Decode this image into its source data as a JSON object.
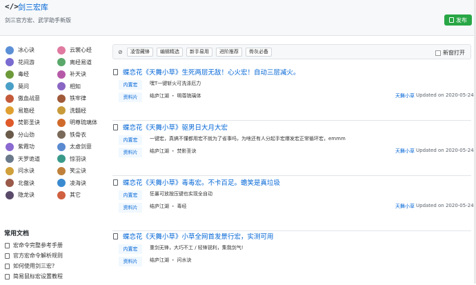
{
  "header": {
    "title": "剑三宏库",
    "subtitle": "剑三官方宏、武学助手新版",
    "publish_label": "发布"
  },
  "sidebar": {
    "categories": [
      {
        "label": "冰心诀",
        "color": "#5b8fd6"
      },
      {
        "label": "云裳心经",
        "color": "#e07aa0"
      },
      {
        "label": "花间游",
        "color": "#7a6bd0"
      },
      {
        "label": "离经易道",
        "color": "#5aa86a"
      },
      {
        "label": "毒经",
        "color": "#6c9a3a"
      },
      {
        "label": "补天诀",
        "color": "#b65aa8"
      },
      {
        "label": "莫问",
        "color": "#4a9fc7"
      },
      {
        "label": "相知",
        "color": "#8a66c4"
      },
      {
        "label": "傲血战意",
        "color": "#c45a3a"
      },
      {
        "label": "铁牢律",
        "color": "#a05a3a"
      },
      {
        "label": "易筋经",
        "color": "#e0a030"
      },
      {
        "label": "洗髓经",
        "color": "#c89a3a"
      },
      {
        "label": "焚影圣诀",
        "color": "#e05a2a"
      },
      {
        "label": "明尊琉璃体",
        "color": "#d06a2a"
      },
      {
        "label": "分山劲",
        "color": "#6a5a4a"
      },
      {
        "label": "铁骨衣",
        "color": "#7a6a5a"
      },
      {
        "label": "紫霞功",
        "color": "#8a6ad0"
      },
      {
        "label": "太虚剑意",
        "color": "#5a8ad0"
      },
      {
        "label": "天罗诡道",
        "color": "#6a7a8a"
      },
      {
        "label": "惊羽诀",
        "color": "#3a9a8a"
      },
      {
        "label": "问水诀",
        "color": "#d0a03a"
      },
      {
        "label": "笑尘诀",
        "color": "#c0803a"
      },
      {
        "label": "北傲诀",
        "color": "#9a5a4a"
      },
      {
        "label": "凌海诀",
        "color": "#3a8ad0"
      },
      {
        "label": "隐龙诀",
        "color": "#5a4a6a"
      },
      {
        "label": "其它",
        "color": "#d06040"
      }
    ],
    "docs_title": "常用文档",
    "docs": [
      "宏命令完整参考手册",
      "官方宏命令解析规则",
      "如何使用剑三宏?",
      "简易鼠标宏设置教程"
    ]
  },
  "tagbar": {
    "tags": [
      "凌雪藏锋",
      "编辑精选",
      "新手易用",
      "进阶推荐",
      "骨灰必备"
    ],
    "new_window_label": "新窗打开"
  },
  "items": [
    {
      "title": "蝶恋花《天舞小草》生死两层无敌！心火宏！自动三层减火。",
      "type": "内置宏",
      "desc": "嘿T一键斩火可洗涤厄力",
      "tag": "资料片",
      "cats": "结庐江湖 ・ 明尊琉璃体",
      "author": "天舞小草",
      "updated": "Updated on 2020-05-24"
    },
    {
      "title": "蝶恋花《天舞小草》驱男日大月大宏",
      "type": "内置宏",
      "desc": "一键宏，真搞不懂都用宏不就为了省事吗，为啥还有人分起手宏爆发宏正常循环宏，emmm",
      "tag": "资料片",
      "cats": "结庐江湖 ・ 焚影圣诀",
      "author": "天舞小草",
      "updated": "Updated on 2020-05-24"
    },
    {
      "title": "蝶恋花《天舞小草》毒毒宏。不卡百足。蟾笑是真垃圾",
      "type": "内置宏",
      "desc": "狂暴可放按压键也实现全自动",
      "tag": "资料片",
      "cats": "结庐江湖 ・ 毒经",
      "author": "天舞小草",
      "updated": "Updated on 2020-05-24"
    },
    {
      "title": "蝶恋花《天舞小草》小草全网首发景行宏，实测可用",
      "type": "内置宏",
      "desc": "重剑无锋，大巧不工 / 轻锋锐利，集我剑气!",
      "tag": "资料片",
      "cats": "结庐江湖 ・ 问水诀",
      "author": "",
      "updated": ""
    }
  ]
}
